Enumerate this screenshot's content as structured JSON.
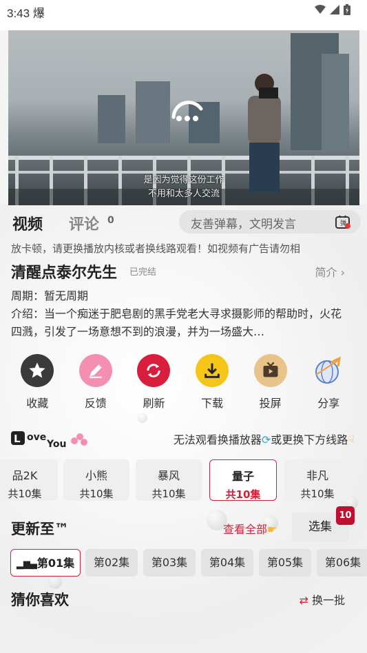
{
  "status_bar": {
    "time": "3:43",
    "extra_icon": "爆"
  },
  "video": {
    "subtitle_line1": "是因为觉得这份工作",
    "subtitle_line2": "不用和太多人交流"
  },
  "tabs": {
    "video": "视频",
    "comment": "评论",
    "comment_count": "0"
  },
  "danmu": {
    "placeholder": "友善弹幕，文明发言"
  },
  "notice": "放卡顿，请更换播放内核或者换线路观看！如视频有广告请勿相",
  "show": {
    "title": "清醒点泰尔先生",
    "status": "已完结",
    "intro_link": "简介 ›",
    "period": "周期：暂无周期",
    "description": "介绍：当一个痴迷于肥皂剧的黑手党老大寻求摄影师的帮助时，火花四溅，引发了一场意想不到的浪漫，并为一场盛大…"
  },
  "actions": [
    {
      "label": "收藏",
      "icon": "star-icon",
      "color": "#3a3a3a"
    },
    {
      "label": "反馈",
      "icon": "pencil-icon",
      "color": "#f48fb1"
    },
    {
      "label": "刷新",
      "icon": "refresh-icon",
      "color": "#d81e3c"
    },
    {
      "label": "下载",
      "icon": "download-icon",
      "color": "#f5c518"
    },
    {
      "label": "投屏",
      "icon": "tv-icon",
      "color": "#e8c48a"
    },
    {
      "label": "分享",
      "icon": "share-globe-icon",
      "color": "#6a8fd8"
    }
  ],
  "lines_tip": {
    "part1": "无法观看换播放器",
    "part2": "或更换下方线路"
  },
  "lines": [
    {
      "name": "品2K",
      "count": "共10集"
    },
    {
      "name": "小熊",
      "count": "共10集"
    },
    {
      "name": "暴风",
      "count": "共10集"
    },
    {
      "name": "量子",
      "count": "共10集",
      "active": true
    },
    {
      "name": "非凡",
      "count": "共10集"
    }
  ],
  "update": {
    "title": "更新至™",
    "view_all": "查看全部",
    "select": "选集",
    "badge": "10"
  },
  "episodes": [
    "第01集",
    "第02集",
    "第03集",
    "第04集",
    "第05集",
    "第06集"
  ],
  "guess": {
    "title": "猜你喜欢",
    "refresh": "换一批"
  },
  "accent": "#c8283c"
}
